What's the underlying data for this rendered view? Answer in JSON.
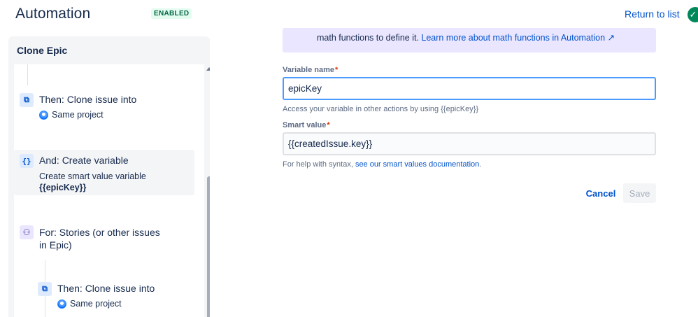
{
  "header": {
    "title": "Automation",
    "badge": "ENABLED",
    "return_link": "Return to list",
    "status_icon": "check-circle-icon",
    "status_color": "#00875a"
  },
  "rule": {
    "name": "Clone Epic",
    "steps": [
      {
        "icon": "copy-icon",
        "title": "Then: Clone issue into",
        "sub": "Same project"
      },
      {
        "icon": "braces-icon",
        "title": "And: Create variable",
        "desc": "Create smart value variable",
        "desc_value": "{{epicKey}}"
      },
      {
        "icon": "branch-icon",
        "title_line1": "For: Stories (or other issues",
        "title_line2": "in Epic)"
      },
      {
        "icon": "copy-icon",
        "title": "Then: Clone issue into",
        "sub": "Same project"
      }
    ]
  },
  "form": {
    "banner_prefix": "math functions to define it.",
    "banner_link": "Learn more about math functions in Automation ↗",
    "variable_label": "Variable name",
    "variable_value": "epicKey",
    "variable_helper": "Access your variable in other actions by using {{epicKey}}",
    "smart_label": "Smart value",
    "smart_value": "{{createdIssue.key}}",
    "smart_helper_prefix": "For help with syntax,",
    "smart_helper_link": "see our smart values documentation",
    "smart_helper_suffix": ".",
    "required_mark": "*",
    "cancel_label": "Cancel",
    "save_label": "Save"
  },
  "colors": {
    "link": "#0052cc",
    "banner_bg": "#eae6ff",
    "focus_border": "#4c9aff"
  }
}
